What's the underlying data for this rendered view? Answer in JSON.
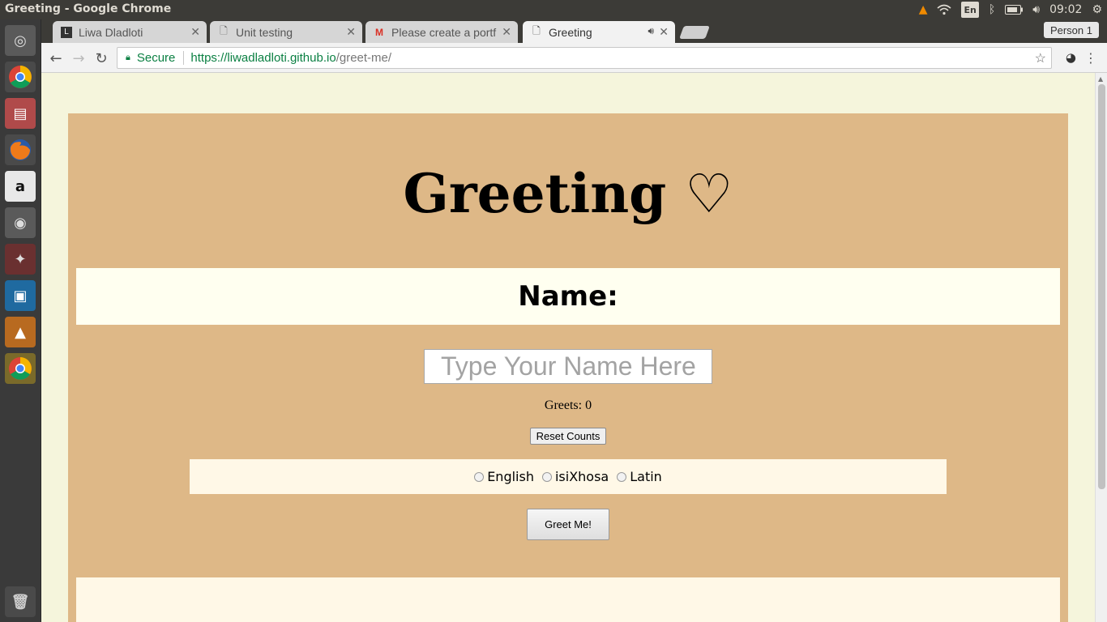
{
  "os": {
    "window_title": "Greeting - Google Chrome",
    "keyboard_layout": "En",
    "clock": "09:02"
  },
  "launcher": {
    "items": [
      "ubuntu-dash",
      "chrome",
      "files",
      "firefox",
      "amazon",
      "media-player",
      "system-settings",
      "vmware",
      "vlc",
      "chrome-active",
      "trash"
    ]
  },
  "browser": {
    "tabs": [
      {
        "label": "Liwa Dladloti",
        "favicon": "page-icon"
      },
      {
        "label": "Unit testing",
        "favicon": "document-icon"
      },
      {
        "label": "Please create a portf",
        "favicon": "gmail-icon"
      },
      {
        "label": "Greeting",
        "favicon": "document-icon",
        "active": true
      }
    ],
    "profile": "Person 1",
    "omnibox": {
      "secure_label": "Secure",
      "scheme": "https://",
      "host": "liwadladloti.github.io",
      "path": "/greet-me/"
    }
  },
  "page": {
    "heading": "Greeting ♡",
    "name_label": "Name:",
    "name_input": {
      "placeholder": "Type Your Name Here",
      "value": ""
    },
    "greets_label": "Greets: 0",
    "reset_button": "Reset Counts",
    "languages": [
      "English",
      "isiXhosa",
      "Latin"
    ],
    "greet_button": "Greet Me!",
    "colors": {
      "page_bg": "#f5f5dc",
      "card_bg": "#deb887",
      "band_bg": "#fffff0"
    }
  }
}
